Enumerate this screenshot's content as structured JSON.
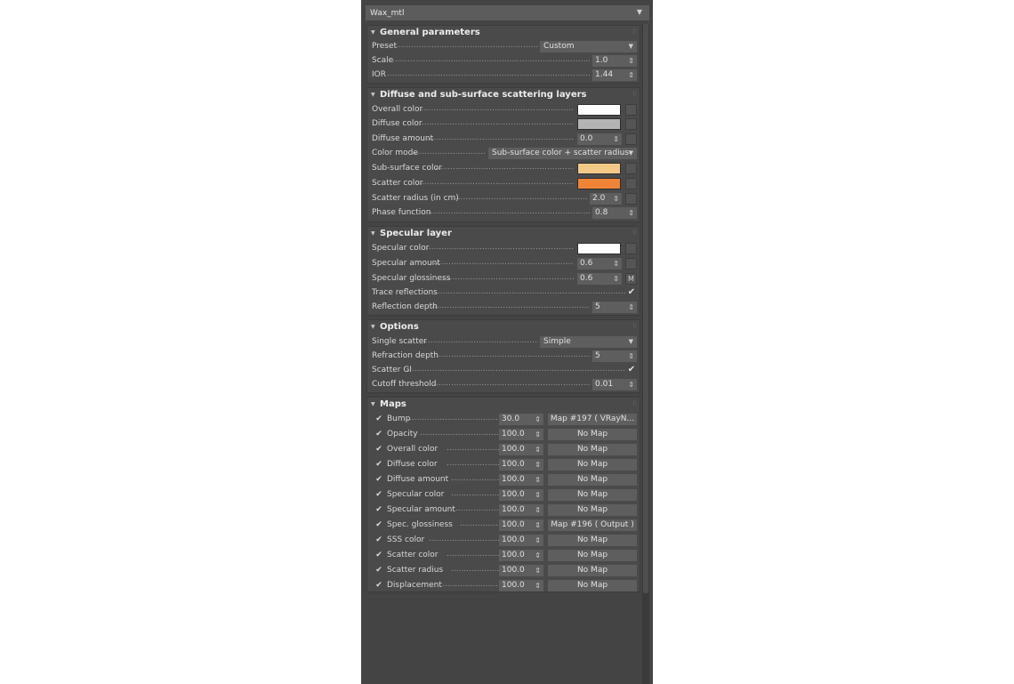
{
  "material": {
    "name": "Wax_mtl"
  },
  "general": {
    "title": "General parameters",
    "preset_label": "Preset",
    "preset_value": "Custom",
    "scale_label": "Scale",
    "scale_value": "1.0",
    "ior_label": "IOR",
    "ior_value": "1.44"
  },
  "diffuse": {
    "title": "Diffuse and sub-surface scattering layers",
    "overall_color_label": "Overall color",
    "overall_color": "#ffffff",
    "diffuse_color_label": "Diffuse color",
    "diffuse_color": "#b4b4b4",
    "diffuse_amount_label": "Diffuse amount",
    "diffuse_amount": "0.0",
    "color_mode_label": "Color mode",
    "color_mode_value": "Sub-surface color + scatter radius",
    "subsurface_color_label": "Sub-surface color",
    "subsurface_color": "#f2c987",
    "scatter_color_label": "Scatter color",
    "scatter_color": "#f08436",
    "scatter_radius_label": "Scatter radius (in cm)",
    "scatter_radius": "2.0",
    "phase_function_label": "Phase function",
    "phase_function": "0.8"
  },
  "specular": {
    "title": "Specular layer",
    "specular_color_label": "Specular color",
    "specular_color": "#ffffff",
    "specular_amount_label": "Specular amount",
    "specular_amount": "0.6",
    "specular_glossiness_label": "Specular glossiness",
    "specular_glossiness": "0.6",
    "glossiness_map_marker": "M",
    "trace_reflections_label": "Trace reflections",
    "reflection_depth_label": "Reflection depth",
    "reflection_depth": "5"
  },
  "options": {
    "title": "Options",
    "single_scatter_label": "Single scatter",
    "single_scatter_value": "Simple",
    "refraction_depth_label": "Refraction depth",
    "refraction_depth": "5",
    "scatter_gi_label": "Scatter GI",
    "cutoff_threshold_label": "Cutoff threshold",
    "cutoff_threshold": "0.01"
  },
  "maps": {
    "title": "Maps",
    "rows": [
      {
        "label": "Bump",
        "amount": "30.0",
        "map": "Map #197  ( VRayN..."
      },
      {
        "label": "Opacity",
        "amount": "100.0",
        "map": "No Map"
      },
      {
        "label": "Overall color",
        "amount": "100.0",
        "map": "No Map"
      },
      {
        "label": "Diffuse color",
        "amount": "100.0",
        "map": "No Map"
      },
      {
        "label": "Diffuse amount",
        "amount": "100.0",
        "map": "No Map"
      },
      {
        "label": "Specular color",
        "amount": "100.0",
        "map": "No Map"
      },
      {
        "label": "Specular amount",
        "amount": "100.0",
        "map": "No Map"
      },
      {
        "label": "Spec. glossiness",
        "amount": "100.0",
        "map": "Map #196  ( Output )"
      },
      {
        "label": "SSS color",
        "amount": "100.0",
        "map": "No Map"
      },
      {
        "label": "Scatter color",
        "amount": "100.0",
        "map": "No Map"
      },
      {
        "label": "Scatter radius",
        "amount": "100.0",
        "map": "No Map"
      },
      {
        "label": "Displacement",
        "amount": "100.0",
        "map": "No Map"
      }
    ]
  },
  "glyphs": {
    "check": "✔",
    "spinner": "⇕",
    "dropdown": "▼",
    "collapse": "▼",
    "grip": "⠿"
  }
}
